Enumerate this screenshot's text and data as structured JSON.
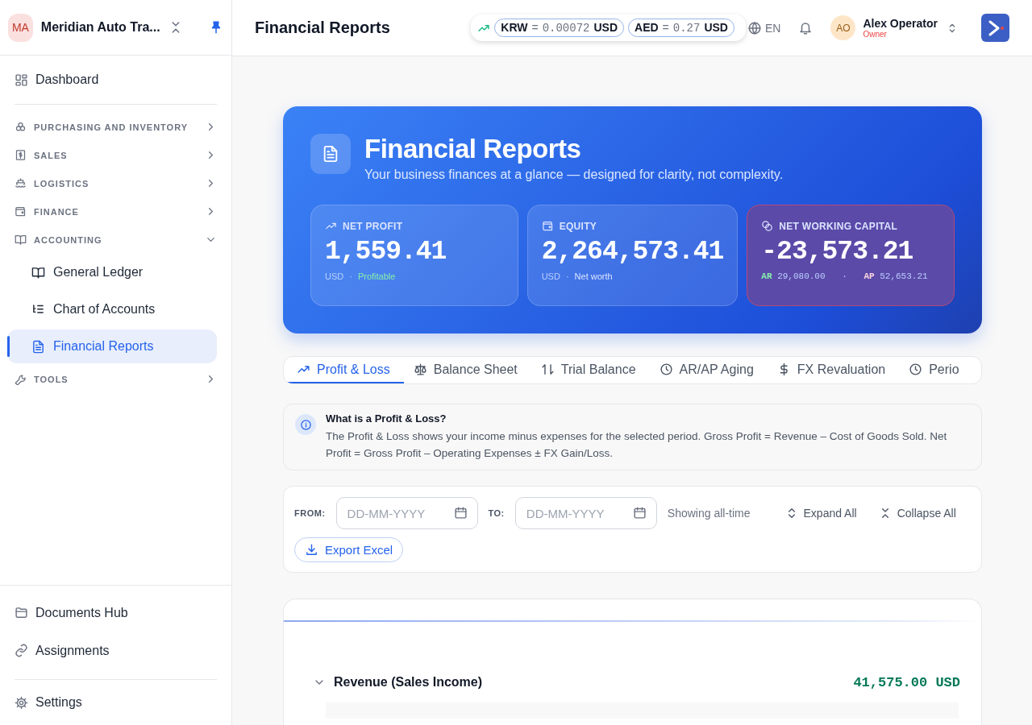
{
  "sidebar": {
    "avatar": "MA",
    "org_name": "Meridian Auto Tra...",
    "top_items": [
      {
        "label": "Dashboard"
      }
    ],
    "sections": [
      {
        "label": "PURCHASING AND INVENTORY",
        "expanded": false
      },
      {
        "label": "SALES",
        "expanded": false
      },
      {
        "label": "LOGISTICS",
        "expanded": false
      },
      {
        "label": "FINANCE",
        "expanded": false
      },
      {
        "label": "ACCOUNTING",
        "expanded": true,
        "children": [
          {
            "label": "General Ledger",
            "selected": false
          },
          {
            "label": "Chart of Accounts",
            "selected": false
          },
          {
            "label": "Financial Reports",
            "selected": true
          }
        ]
      },
      {
        "label": "TOOLS",
        "expanded": false
      }
    ],
    "bottom_items": [
      {
        "label": "Documents Hub"
      },
      {
        "label": "Assignments"
      }
    ],
    "settings": {
      "label": "Settings"
    }
  },
  "header": {
    "title": "Financial Reports",
    "rates": [
      {
        "code": "KRW",
        "eq": "=",
        "value": "0.00072",
        "unit": "USD"
      },
      {
        "code": "AED",
        "eq": "=",
        "value": "0.27",
        "unit": "USD"
      }
    ],
    "language": "EN",
    "user": {
      "initials": "AO",
      "name": "Alex Operator",
      "role": "Owner"
    }
  },
  "hero": {
    "title": "Financial Reports",
    "subtitle": "Your business finances at a glance — designed for clarity, not complexity.",
    "kpis": [
      {
        "kind": "standard",
        "label": "NET PROFIT",
        "value": "1,559.41",
        "unit": "USD",
        "sep": "·",
        "note": "Profitable",
        "positive": true
      },
      {
        "kind": "standard",
        "label": "EQUITY",
        "value": "2,264,573.41",
        "unit": "USD",
        "sep": "·",
        "note": "Net worth",
        "positive": false
      },
      {
        "kind": "alert",
        "label": "NET WORKING CAPITAL",
        "value": "-23,573.21",
        "ar_label": "AR",
        "ar_value": "29,080.00",
        "sep": "·",
        "ap_label": "AP",
        "ap_value": "52,653.21"
      }
    ]
  },
  "tabs": [
    {
      "label": "Profit & Loss",
      "selected": true
    },
    {
      "label": "Balance Sheet",
      "selected": false
    },
    {
      "label": "Trial Balance",
      "selected": false
    },
    {
      "label": "AR/AP Aging",
      "selected": false
    },
    {
      "label": "FX Revaluation",
      "selected": false
    },
    {
      "label": "Perio",
      "selected": false
    }
  ],
  "info": {
    "title": "What is a Profit & Loss?",
    "body": "The Profit & Loss shows your income minus expenses for the selected period. Gross Profit = Revenue – Cost of Goods Sold. Net Profit = Gross Profit – Operating Expenses ± FX Gain/Loss."
  },
  "filters": {
    "from_label": "FROM:",
    "from": {
      "placeholder": "DD-MM-YYYY"
    },
    "to_label": "TO:",
    "to": {
      "placeholder": "DD-MM-YYYY"
    },
    "status": "Showing all-time",
    "expand": "Expand All",
    "collapse": "Collapse All",
    "export": "Export Excel"
  },
  "report": {
    "sections": [
      {
        "label": "Revenue (Sales Income)",
        "amount": "41,575.00 USD",
        "expanded": true
      }
    ]
  }
}
